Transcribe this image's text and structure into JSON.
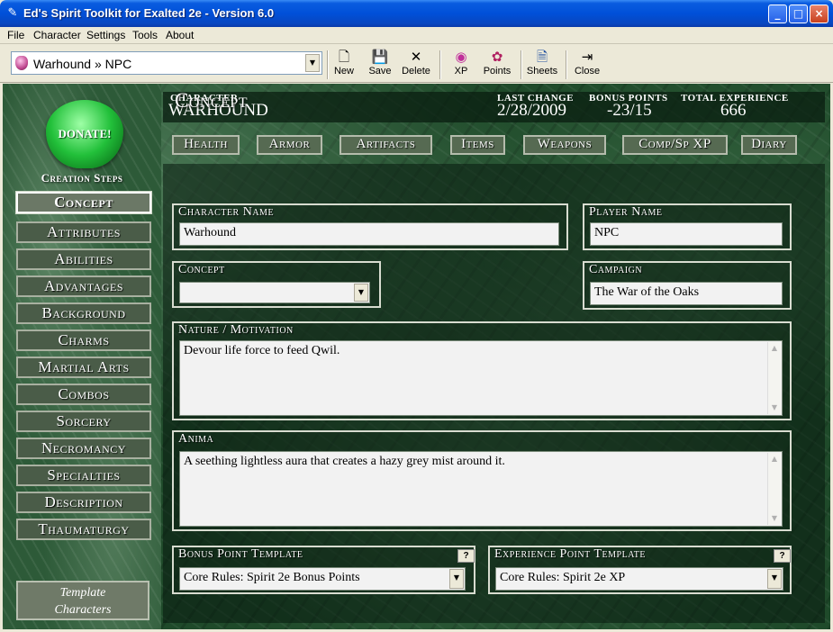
{
  "window": {
    "title": "Ed's Spirit Toolkit for Exalted 2e - Version 6.0",
    "app_icon": "spirit-app-icon",
    "minimize": "_",
    "maximize": "□",
    "close": "×"
  },
  "menu": [
    "File",
    "Character",
    "Settings",
    "Tools",
    "About"
  ],
  "toolbar": {
    "character_select": "Warhound » NPC",
    "buttons": [
      {
        "label": "New",
        "icon": "🗋"
      },
      {
        "label": "Save",
        "icon": "💾"
      },
      {
        "label": "Delete",
        "icon": "✕"
      },
      {
        "label": "XP",
        "icon": "◉"
      },
      {
        "label": "Points",
        "icon": "✿"
      },
      {
        "label": "Sheets",
        "icon": "🗎"
      },
      {
        "label": "Close",
        "icon": "⇥"
      }
    ]
  },
  "sidebar": {
    "donate_label": "DONATE!",
    "steps_title": "Creation Steps",
    "steps": [
      "Concept",
      "Attributes",
      "Abilities",
      "Advantages",
      "Background",
      "Charms",
      "Martial Arts",
      "Combos",
      "Sorcery",
      "Necromancy",
      "Specialties",
      "Description",
      "Thaumaturgy"
    ],
    "templates_line1": "Template",
    "templates_line2": "Characters"
  },
  "header": {
    "character_label": "CHARACTER",
    "character_value": "WARHOUND",
    "last_change_label": "LAST CHANGE",
    "last_change_value": "2/28/2009",
    "bonus_points_label": "BONUS POINTS",
    "bonus_points_value": "-23/15",
    "total_xp_label": "TOTAL EXPERIENCE",
    "total_xp_value": "666"
  },
  "tabs": [
    "Health",
    "Armor",
    "Artifacts",
    "Items",
    "Weapons",
    "Comp/Sp XP",
    "Diary"
  ],
  "concept": {
    "page_title": "Concept",
    "character_name_label": "Character Name",
    "character_name_value": "Warhound",
    "player_name_label": "Player Name",
    "player_name_value": "NPC",
    "concept_label": "Concept",
    "concept_value": "",
    "campaign_label": "Campaign",
    "campaign_value": "The War of the Oaks",
    "nature_label": "Nature / Motivation",
    "nature_value": "Devour life force to feed Qwil.",
    "anima_label": "Anima",
    "anima_value": "A seething lightless aura that creates a hazy grey mist around it.",
    "bonus_template_label": "Bonus Point Template",
    "bonus_template_value": "Core Rules: Spirit 2e Bonus Points",
    "xp_template_label": "Experience Point Template",
    "xp_template_value": "Core Rules: Spirit 2e XP",
    "help_label": "?"
  }
}
